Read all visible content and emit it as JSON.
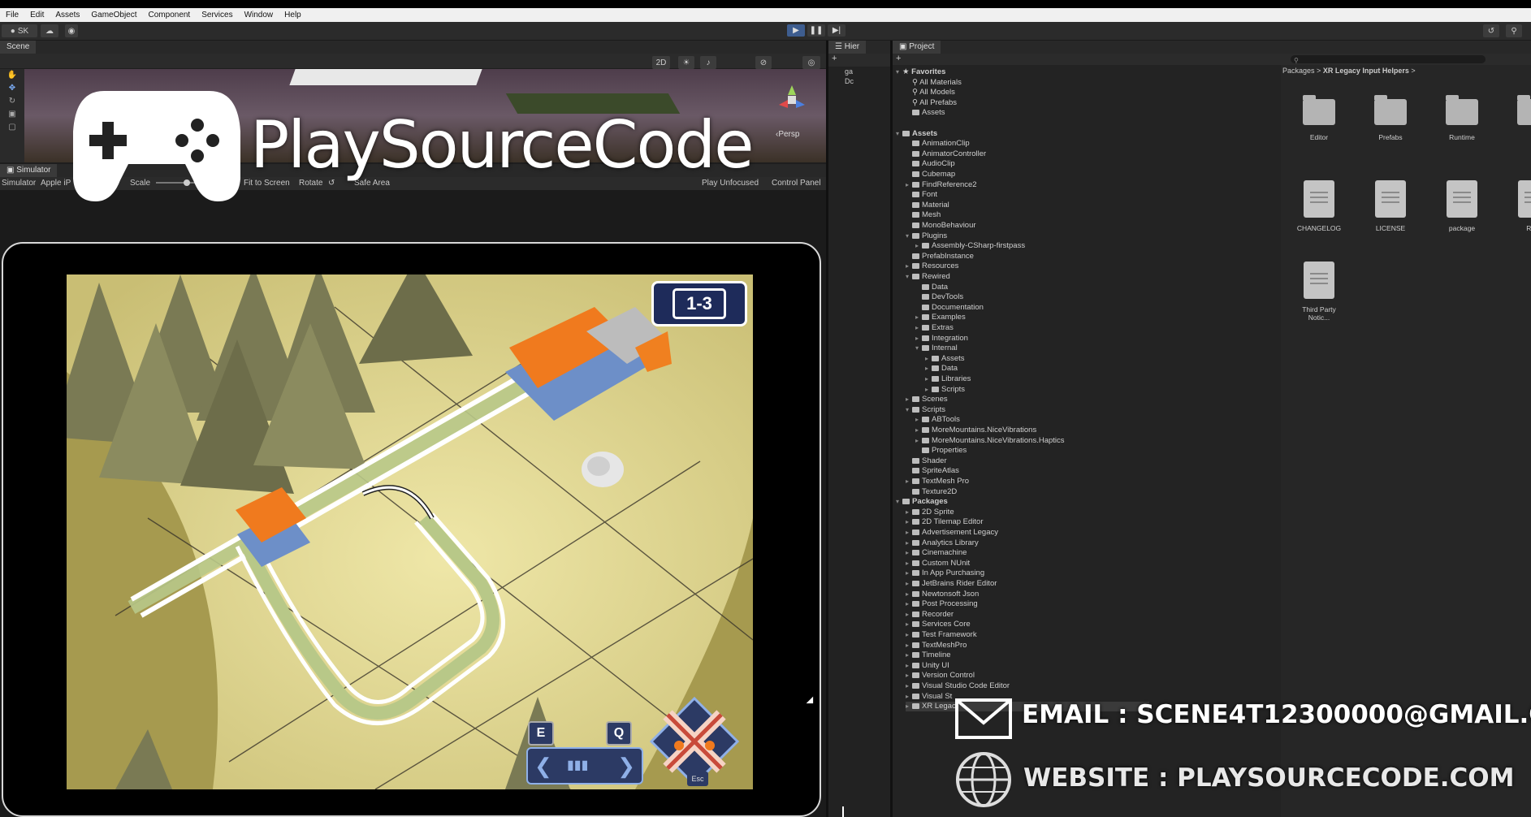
{
  "menu": [
    "File",
    "Edit",
    "Assets",
    "GameObject",
    "Component",
    "Services",
    "Window",
    "Help"
  ],
  "toolbar": {
    "account": "SK",
    "view_2d": "2D"
  },
  "scene": {
    "tab": "Scene",
    "persp": "‹Persp"
  },
  "simulator": {
    "tab": "Simulator",
    "device_select": "Simulator",
    "device": "Apple iP",
    "scale_label": "Scale",
    "fit_label": "Fit to Screen",
    "rotate_label": "Rotate",
    "safe_area_label": "Safe Area",
    "play_mode": "Play Unfocused",
    "control_panel": "Control Panel"
  },
  "game": {
    "level": "1-3",
    "key_e": "E",
    "key_q": "Q",
    "key_esc": "Esc"
  },
  "hierarchy": {
    "tab": "Hier",
    "rows": [
      "ga",
      "Dc"
    ]
  },
  "project": {
    "tab": "Project",
    "breadcrumb": [
      "Packages",
      "XR Legacy Input Helpers"
    ],
    "tree": [
      {
        "label": "Favorites",
        "level": 0,
        "arrow": "▾",
        "type": "star"
      },
      {
        "label": "All Materials",
        "level": 1,
        "arrow": "",
        "type": "search"
      },
      {
        "label": "All Models",
        "level": 1,
        "arrow": "",
        "type": "search"
      },
      {
        "label": "All Prefabs",
        "level": 1,
        "arrow": "",
        "type": "search"
      },
      {
        "label": "Assets",
        "level": 1,
        "arrow": "",
        "type": "folder"
      },
      {
        "label": "",
        "level": 0,
        "arrow": "",
        "type": "gap"
      },
      {
        "label": "Assets",
        "level": 0,
        "arrow": "▾",
        "type": "folder"
      },
      {
        "label": "AnimationClip",
        "level": 1,
        "arrow": "",
        "type": "folder"
      },
      {
        "label": "AnimatorController",
        "level": 1,
        "arrow": "",
        "type": "folder"
      },
      {
        "label": "AudioClip",
        "level": 1,
        "arrow": "",
        "type": "folder"
      },
      {
        "label": "Cubemap",
        "level": 1,
        "arrow": "",
        "type": "folder"
      },
      {
        "label": "FindReference2",
        "level": 1,
        "arrow": "▸",
        "type": "folder"
      },
      {
        "label": "Font",
        "level": 1,
        "arrow": "",
        "type": "folder"
      },
      {
        "label": "Material",
        "level": 1,
        "arrow": "",
        "type": "folder"
      },
      {
        "label": "Mesh",
        "level": 1,
        "arrow": "",
        "type": "folder"
      },
      {
        "label": "MonoBehaviour",
        "level": 1,
        "arrow": "",
        "type": "folder"
      },
      {
        "label": "Plugins",
        "level": 1,
        "arrow": "▾",
        "type": "folder"
      },
      {
        "label": "Assembly-CSharp-firstpass",
        "level": 2,
        "arrow": "▸",
        "type": "folder"
      },
      {
        "label": "PrefabInstance",
        "level": 1,
        "arrow": "",
        "type": "folder"
      },
      {
        "label": "Resources",
        "level": 1,
        "arrow": "▸",
        "type": "folder"
      },
      {
        "label": "Rewired",
        "level": 1,
        "arrow": "▾",
        "type": "folder"
      },
      {
        "label": "Data",
        "level": 2,
        "arrow": "",
        "type": "folder"
      },
      {
        "label": "DevTools",
        "level": 2,
        "arrow": "",
        "type": "folder"
      },
      {
        "label": "Documentation",
        "level": 2,
        "arrow": "",
        "type": "folder"
      },
      {
        "label": "Examples",
        "level": 2,
        "arrow": "▸",
        "type": "folder"
      },
      {
        "label": "Extras",
        "level": 2,
        "arrow": "▸",
        "type": "folder"
      },
      {
        "label": "Integration",
        "level": 2,
        "arrow": "▸",
        "type": "folder"
      },
      {
        "label": "Internal",
        "level": 2,
        "arrow": "▾",
        "type": "folder"
      },
      {
        "label": "Assets",
        "level": 3,
        "arrow": "▸",
        "type": "folder"
      },
      {
        "label": "Data",
        "level": 3,
        "arrow": "▸",
        "type": "folder"
      },
      {
        "label": "Libraries",
        "level": 3,
        "arrow": "▸",
        "type": "folder"
      },
      {
        "label": "Scripts",
        "level": 3,
        "arrow": "▸",
        "type": "folder"
      },
      {
        "label": "Scenes",
        "level": 1,
        "arrow": "▸",
        "type": "folder"
      },
      {
        "label": "Scripts",
        "level": 1,
        "arrow": "▾",
        "type": "folder"
      },
      {
        "label": "ABTools",
        "level": 2,
        "arrow": "▸",
        "type": "folder"
      },
      {
        "label": "MoreMountains.NiceVibrations",
        "level": 2,
        "arrow": "▸",
        "type": "folder"
      },
      {
        "label": "MoreMountains.NiceVibrations.Haptics",
        "level": 2,
        "arrow": "▸",
        "type": "folder"
      },
      {
        "label": "Properties",
        "level": 2,
        "arrow": "",
        "type": "openfolder"
      },
      {
        "label": "Shader",
        "level": 1,
        "arrow": "",
        "type": "folder"
      },
      {
        "label": "SpriteAtlas",
        "level": 1,
        "arrow": "",
        "type": "folder"
      },
      {
        "label": "TextMesh Pro",
        "level": 1,
        "arrow": "▸",
        "type": "folder"
      },
      {
        "label": "Texture2D",
        "level": 1,
        "arrow": "",
        "type": "folder"
      },
      {
        "label": "Packages",
        "level": 0,
        "arrow": "▾",
        "type": "folder"
      },
      {
        "label": "2D Sprite",
        "level": 1,
        "arrow": "▸",
        "type": "folder"
      },
      {
        "label": "2D Tilemap Editor",
        "level": 1,
        "arrow": "▸",
        "type": "folder"
      },
      {
        "label": "Advertisement Legacy",
        "level": 1,
        "arrow": "▸",
        "type": "folder"
      },
      {
        "label": "Analytics Library",
        "level": 1,
        "arrow": "▸",
        "type": "folder"
      },
      {
        "label": "Cinemachine",
        "level": 1,
        "arrow": "▸",
        "type": "folder"
      },
      {
        "label": "Custom NUnit",
        "level": 1,
        "arrow": "▸",
        "type": "folder"
      },
      {
        "label": "In App Purchasing",
        "level": 1,
        "arrow": "▸",
        "type": "folder"
      },
      {
        "label": "JetBrains Rider Editor",
        "level": 1,
        "arrow": "▸",
        "type": "folder"
      },
      {
        "label": "Newtonsoft Json",
        "level": 1,
        "arrow": "▸",
        "type": "folder"
      },
      {
        "label": "Post Processing",
        "level": 1,
        "arrow": "▸",
        "type": "folder"
      },
      {
        "label": "Recorder",
        "level": 1,
        "arrow": "▸",
        "type": "folder"
      },
      {
        "label": "Services Core",
        "level": 1,
        "arrow": "▸",
        "type": "folder"
      },
      {
        "label": "Test Framework",
        "level": 1,
        "arrow": "▸",
        "type": "folder"
      },
      {
        "label": "TextMeshPro",
        "level": 1,
        "arrow": "▸",
        "type": "folder"
      },
      {
        "label": "Timeline",
        "level": 1,
        "arrow": "▸",
        "type": "folder"
      },
      {
        "label": "Unity UI",
        "level": 1,
        "arrow": "▸",
        "type": "folder"
      },
      {
        "label": "Version Control",
        "level": 1,
        "arrow": "▸",
        "type": "folder"
      },
      {
        "label": "Visual Studio Code Editor",
        "level": 1,
        "arrow": "▸",
        "type": "folder"
      },
      {
        "label": "Visual St",
        "level": 1,
        "arrow": "▸",
        "type": "folder"
      },
      {
        "label": "XR Legac",
        "level": 1,
        "arrow": "▸",
        "type": "folder",
        "selected": true
      }
    ],
    "grid": [
      {
        "label": "Editor",
        "type": "folder"
      },
      {
        "label": "Prefabs",
        "type": "folder"
      },
      {
        "label": "Runtime",
        "type": "folder"
      },
      {
        "label": "T",
        "type": "folder"
      },
      {
        "label": "CHANGELOG",
        "type": "doc"
      },
      {
        "label": "LICENSE",
        "type": "doc"
      },
      {
        "label": "package",
        "type": "doc"
      },
      {
        "label": "REA",
        "type": "doc"
      },
      {
        "label": "Third Party Notic...",
        "type": "doc"
      }
    ]
  },
  "watermark": {
    "logo": "PlaySourceCode",
    "email": "EMAIL : SCENE4T12300000@GMAIL.C",
    "website": "WEBSITE : PLAYSOURCECODE.COM"
  }
}
